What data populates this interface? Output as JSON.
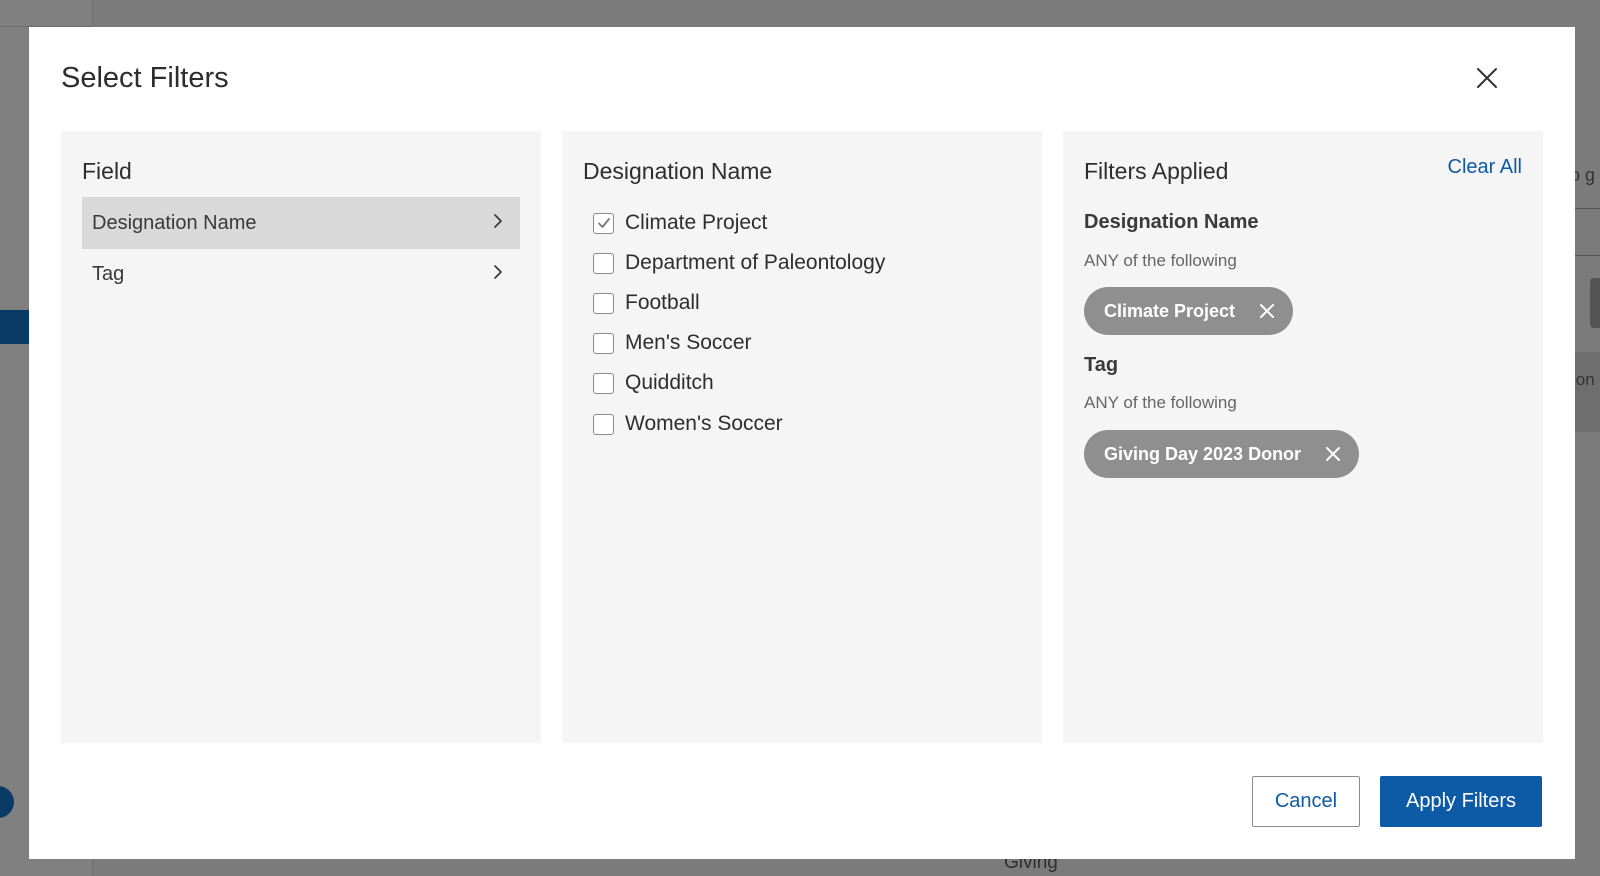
{
  "background": {
    "bottom_text": "Giving",
    "right_text_top": "o g",
    "right_text_mid": "ion"
  },
  "modal": {
    "title": "Select Filters"
  },
  "field_column": {
    "heading": "Field",
    "items": [
      {
        "label": "Designation Name",
        "active": true
      },
      {
        "label": "Tag",
        "active": false
      }
    ]
  },
  "values_column": {
    "heading": "Designation Name",
    "options": [
      {
        "label": "Climate Project",
        "checked": true
      },
      {
        "label": "Department of Paleontology",
        "checked": false
      },
      {
        "label": "Football",
        "checked": false
      },
      {
        "label": "Men's Soccer",
        "checked": false
      },
      {
        "label": "Quidditch",
        "checked": false
      },
      {
        "label": "Women's Soccer",
        "checked": false
      }
    ]
  },
  "applied_column": {
    "heading": "Filters Applied",
    "clear_all": "Clear All",
    "groups": [
      {
        "title": "Designation Name",
        "subtitle": "ANY of the following",
        "chips": [
          "Climate Project"
        ]
      },
      {
        "title": "Tag",
        "subtitle": "ANY of the following",
        "chips": [
          "Giving Day 2023 Donor"
        ]
      }
    ]
  },
  "footer": {
    "cancel_label": "Cancel",
    "apply_label": "Apply Filters"
  },
  "colors": {
    "accent": "#0d5aa7",
    "chip_bg": "#8f8f8f",
    "overlay": "#7b7b7b"
  }
}
